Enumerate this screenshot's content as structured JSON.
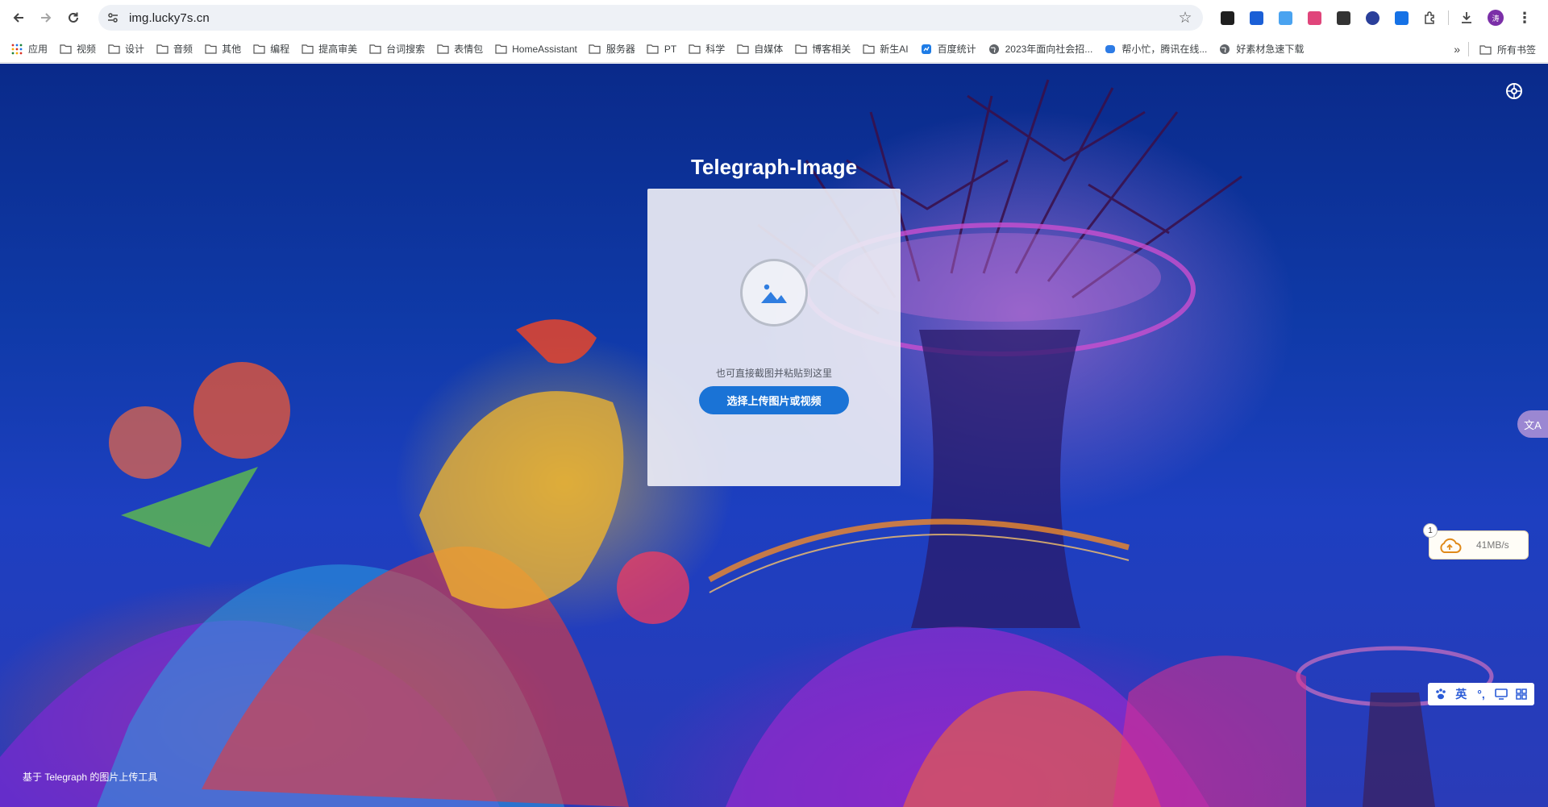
{
  "browser": {
    "url": "img.lucky7s.cn",
    "avatar_text": "涛",
    "extensions": [
      {
        "name": "ext-1",
        "color": "#1f1f1f"
      },
      {
        "name": "ext-2",
        "color": "#1b5fd6"
      },
      {
        "name": "ext-3",
        "color": "#4aa3f0"
      },
      {
        "name": "ext-4",
        "color": "#e0457b"
      },
      {
        "name": "ext-5",
        "color": "#333333"
      },
      {
        "name": "ext-6",
        "color": "#2a3f9a"
      },
      {
        "name": "ext-7",
        "color": "#1672e6"
      }
    ]
  },
  "bookmarks": {
    "apps_label": "应用",
    "items": [
      "视频",
      "设计",
      "音频",
      "其他",
      "编程",
      "提高审美",
      "台词搜索",
      "表情包",
      "HomeAssistant",
      "服务器",
      "PT",
      "科学",
      "自媒体",
      "博客相关",
      "新生AI",
      "百度统计",
      "2023年面向社会招...",
      "帮小忙，腾讯在线...",
      "好素材急速下载"
    ],
    "all_bookmarks": "所有书签"
  },
  "app": {
    "title": "Telegraph-Image",
    "paste_hint": "也可直接截图并粘贴到这里",
    "upload_button": "选择上传图片或视频",
    "footer": "基于 Telegraph 的图片上传工具"
  },
  "widgets": {
    "speed_badge": "1",
    "speed": "41MB/s",
    "ime_lang": "英",
    "ime_punct": "°,"
  },
  "colors": {
    "primary_button": "#1a73d6",
    "avatar": "#7b2fa8"
  }
}
